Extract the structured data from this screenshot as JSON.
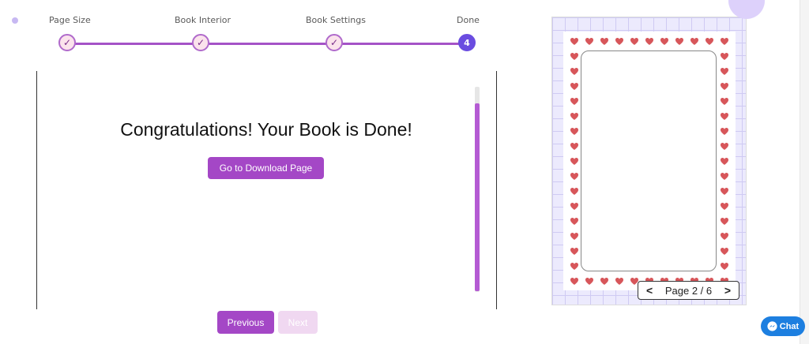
{
  "stepper": {
    "steps": [
      {
        "label": "Page Size",
        "status": "completed",
        "glyph": "✓"
      },
      {
        "label": "Book Interior",
        "status": "completed",
        "glyph": "✓"
      },
      {
        "label": "Book Settings",
        "status": "completed",
        "glyph": "✓"
      },
      {
        "label": "Done",
        "status": "current",
        "glyph": "4"
      }
    ]
  },
  "main": {
    "heading": "Congratulations! Your Book is Done!",
    "download_label": "Go to Download Page"
  },
  "nav": {
    "previous_label": "Previous",
    "next_label": "Next"
  },
  "preview": {
    "page_text": "Page 2 / 6",
    "prev_arrow": "<",
    "next_arrow": ">",
    "border_icon": "heart-icon"
  },
  "chat": {
    "label": "Chat",
    "icon": "messenger-icon"
  },
  "colors": {
    "accent": "#a447c6",
    "accent_disabled": "#f0d8f1",
    "step_active": "#6a4ce0",
    "heart": "#d7565a",
    "grid_bg": "#eceafd",
    "chat": "#1d7fe0"
  }
}
